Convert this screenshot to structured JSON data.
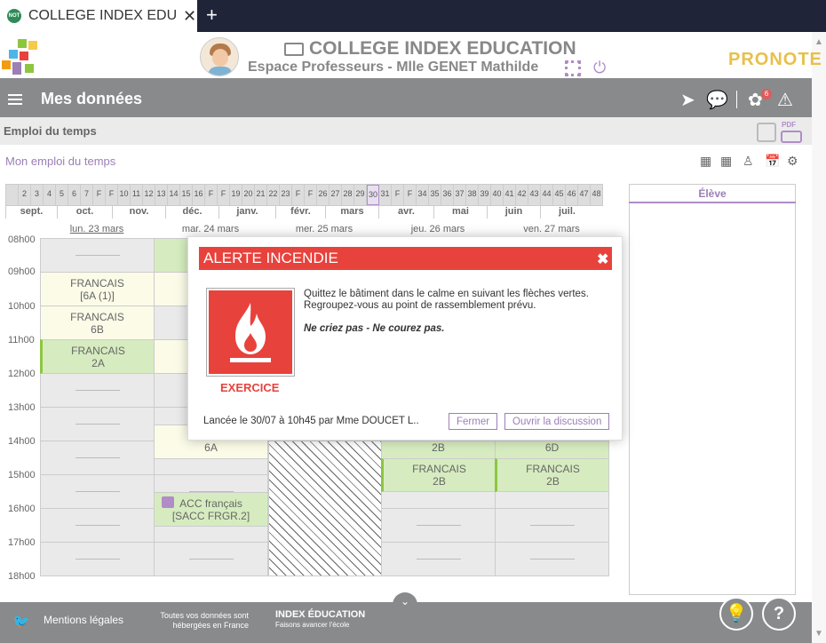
{
  "browser": {
    "tab_title": "COLLEGE INDEX EDUCATION",
    "close": "✕",
    "newtab": "+",
    "favicon": "NOT"
  },
  "header": {
    "school": "COLLEGE INDEX EDUCATION",
    "space": "Espace Professeurs - Mlle GENET Mathilde",
    "brand": "PRONOTE"
  },
  "toolbar": {
    "title": "Mes données",
    "badge": "6"
  },
  "section": {
    "title": "Emploi du temps",
    "pdf": "PDF",
    "subtitle": "Mon emploi du temps"
  },
  "weeks": [
    "",
    "2",
    "3",
    "4",
    "5",
    "6",
    "7",
    "F",
    "F",
    "10",
    "11",
    "12",
    "13",
    "14",
    "15",
    "16",
    "F",
    "F",
    "19",
    "20",
    "21",
    "22",
    "23",
    "F",
    "F",
    "26",
    "27",
    "28",
    "29",
    "30",
    "31",
    "F",
    "F",
    "34",
    "35",
    "36",
    "37",
    "38",
    "39",
    "40",
    "41",
    "42",
    "43",
    "44",
    "45",
    "46",
    "47",
    "48"
  ],
  "months": [
    "sept.",
    "oct.",
    "nov.",
    "déc.",
    "janv.",
    "févr.",
    "mars",
    "avr.",
    "mai",
    "juin",
    "juil."
  ],
  "days": [
    "lun. 23 mars",
    "mar. 24 mars",
    "mer. 25 mars",
    "jeu. 26 mars",
    "ven. 27 mars"
  ],
  "hours": [
    "08h00",
    "09h00",
    "10h00",
    "11h00",
    "12h00",
    "13h00",
    "14h00",
    "15h00",
    "16h00",
    "17h00",
    "18h00"
  ],
  "lessons": {
    "l1a": "FRANCAIS",
    "l1b": "[6A (1)]",
    "l2a": "FRANCAIS",
    "l2b": "6B",
    "l3a": "FRANCAIS",
    "l3b": "2A",
    "m1": "6A",
    "m2a": "ACC français",
    "m2b": "[SACC FRGR.2]",
    "j1": "2B",
    "j2a": "FRANCAIS",
    "j2b": "2B",
    "v1": "6D",
    "v2a": "FRANCAIS",
    "v2b": "2B"
  },
  "side": {
    "title": "Élève"
  },
  "alert": {
    "title": "ALERTE INCENDIE",
    "close": "✖",
    "label": "EXERCICE",
    "line1": "Quittez le bâtiment dans le calme en suivant les flèches vertes.",
    "line2": "Regroupez-vous au point de rassemblement prévu.",
    "line3": "Ne criez pas - Ne courez pas.",
    "launched": "Lancée le 30/07 à 10h45 par Mme DOUCET L..",
    "btn_close": "Fermer",
    "btn_discuss": "Ouvrir la discussion"
  },
  "footer": {
    "legal": "Mentions légales",
    "hosted1": "Toutes vos données sont",
    "hosted2": "hébergées en France",
    "idx1": "INDEX ÉDUCATION",
    "idx2": "Faisons avancer l'école",
    "help": "?"
  },
  "colors": {
    "alert": "#e8423c",
    "accent": "#9b7fb5",
    "toolbar": "#888a8c",
    "lesson_green": "#d6ecc0",
    "lesson_yellow": "#fbfbe8"
  }
}
